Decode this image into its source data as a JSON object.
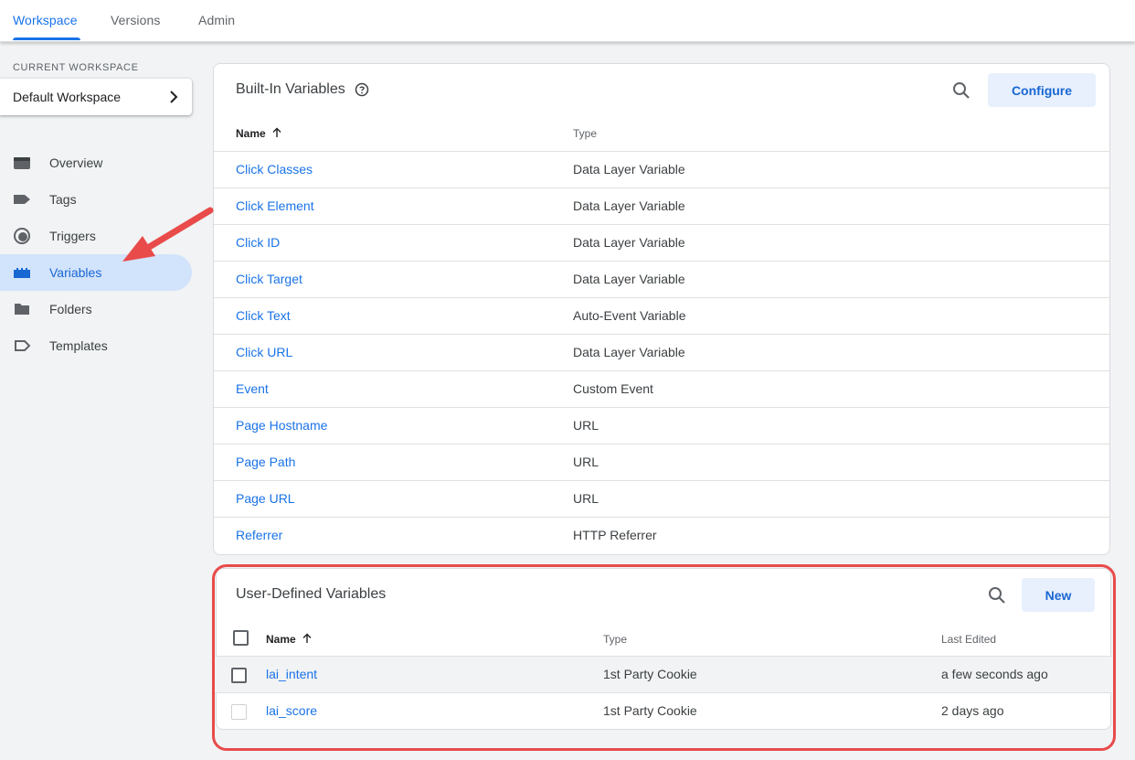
{
  "nav": {
    "tabs": [
      {
        "label": "Workspace",
        "active": true
      },
      {
        "label": "Versions",
        "active": false
      },
      {
        "label": "Admin",
        "active": false
      }
    ]
  },
  "sidebar": {
    "caption": "CURRENT WORKSPACE",
    "workspace": "Default Workspace",
    "items": [
      {
        "label": "Overview",
        "icon": "overview-icon"
      },
      {
        "label": "Tags",
        "icon": "tag-icon"
      },
      {
        "label": "Triggers",
        "icon": "trigger-icon"
      },
      {
        "label": "Variables",
        "icon": "variables-icon",
        "active": true
      },
      {
        "label": "Folders",
        "icon": "folder-icon"
      },
      {
        "label": "Templates",
        "icon": "template-icon"
      }
    ]
  },
  "builtin": {
    "title": "Built-In Variables",
    "configure_label": "Configure",
    "col_name": "Name",
    "col_type": "Type",
    "rows": [
      {
        "name": "Click Classes",
        "type": "Data Layer Variable"
      },
      {
        "name": "Click Element",
        "type": "Data Layer Variable"
      },
      {
        "name": "Click ID",
        "type": "Data Layer Variable"
      },
      {
        "name": "Click Target",
        "type": "Data Layer Variable"
      },
      {
        "name": "Click Text",
        "type": "Auto-Event Variable"
      },
      {
        "name": "Click URL",
        "type": "Data Layer Variable"
      },
      {
        "name": "Event",
        "type": "Custom Event"
      },
      {
        "name": "Page Hostname",
        "type": "URL"
      },
      {
        "name": "Page Path",
        "type": "URL"
      },
      {
        "name": "Page URL",
        "type": "URL"
      },
      {
        "name": "Referrer",
        "type": "HTTP Referrer"
      }
    ]
  },
  "userdefined": {
    "title": "User-Defined Variables",
    "new_label": "New",
    "col_name": "Name",
    "col_type": "Type",
    "col_edited": "Last Edited",
    "rows": [
      {
        "name": "lai_intent",
        "type": "1st Party Cookie",
        "edited": "a few seconds ago"
      },
      {
        "name": "lai_score",
        "type": "1st Party Cookie",
        "edited": "2 days ago"
      }
    ]
  },
  "colors": {
    "accent": "#1a73e8",
    "annotation_red": "#e94b4b"
  }
}
